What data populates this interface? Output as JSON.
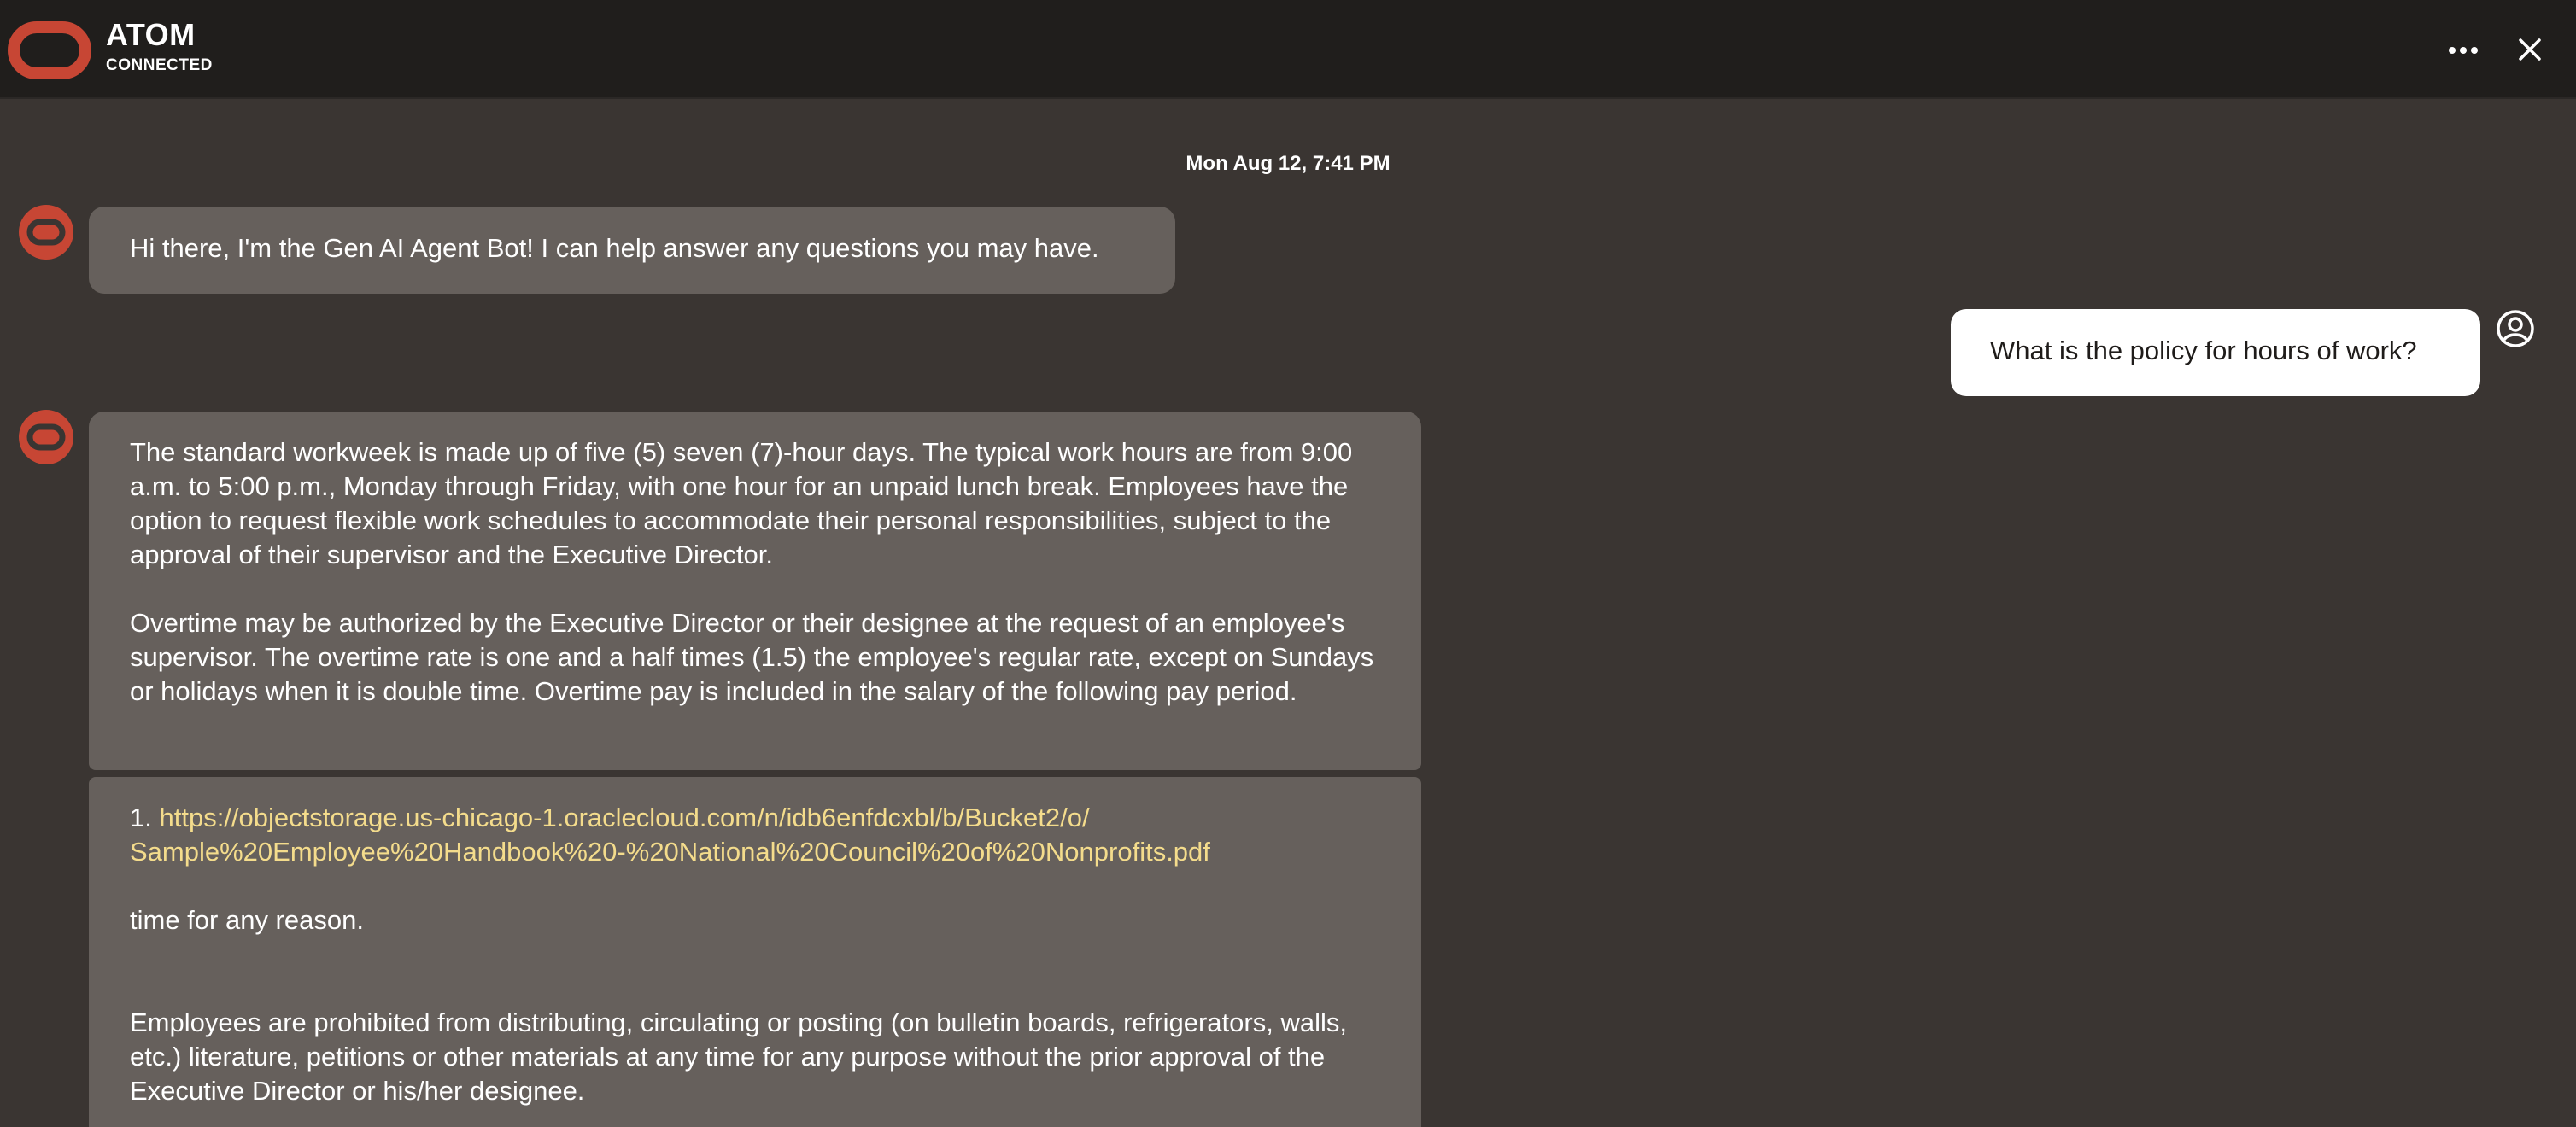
{
  "header": {
    "title": "ATOM",
    "status": "CONNECTED",
    "logo_icon": "oracle-logo-icon",
    "more_icon": "more-horizontal-icon",
    "close_icon": "close-icon"
  },
  "colors": {
    "background": "#3a3532",
    "header_bg": "#201e1c",
    "bot_bubble": "#66605c",
    "user_bubble": "#ffffff",
    "brand": "#c74634",
    "link": "#f4dc8c"
  },
  "conversation": {
    "timestamp": "Mon Aug 12, 7:41 PM",
    "greeting": "Hi there, I'm the Gen AI Agent Bot! I can help answer any questions you may have.",
    "user_question": "What is the policy for hours of work?",
    "answer_paragraphs": [
      "The standard workweek is made up of five (5) seven (7)-hour days. The typical work hours are from 9:00 a.m. to 5:00 p.m., Monday through Friday, with one hour for an unpaid lunch break. Employees have the option to request flexible work schedules to accommodate their personal responsibilities, subject to the approval of their supervisor and the Executive Director.",
      "Overtime may be authorized by the Executive Director or their designee at the request of an employee's supervisor. The overtime rate is one and a half times (1.5) the employee's regular rate, except on Sundays or holidays when it is double time. Overtime pay is included in the salary of the following pay period."
    ],
    "citation": {
      "number": "1.",
      "url_line1": "https://objectstorage.us-chicago-1.oraclecloud.com/n/idb6enfdcxbl/b/Bucket2/o/",
      "url_line2": "Sample%20Employee%20Handbook%20-%20National%20Council%20of%20Nonprofits.pdf",
      "snippet1": "time for any reason.",
      "snippet2": "Employees are prohibited from distributing, circulating or posting (on bulletin boards, refrigerators, walls, etc.) literature, petitions or other materials at any time for any purpose without the prior approval of the Executive Director or his/her designee."
    }
  }
}
